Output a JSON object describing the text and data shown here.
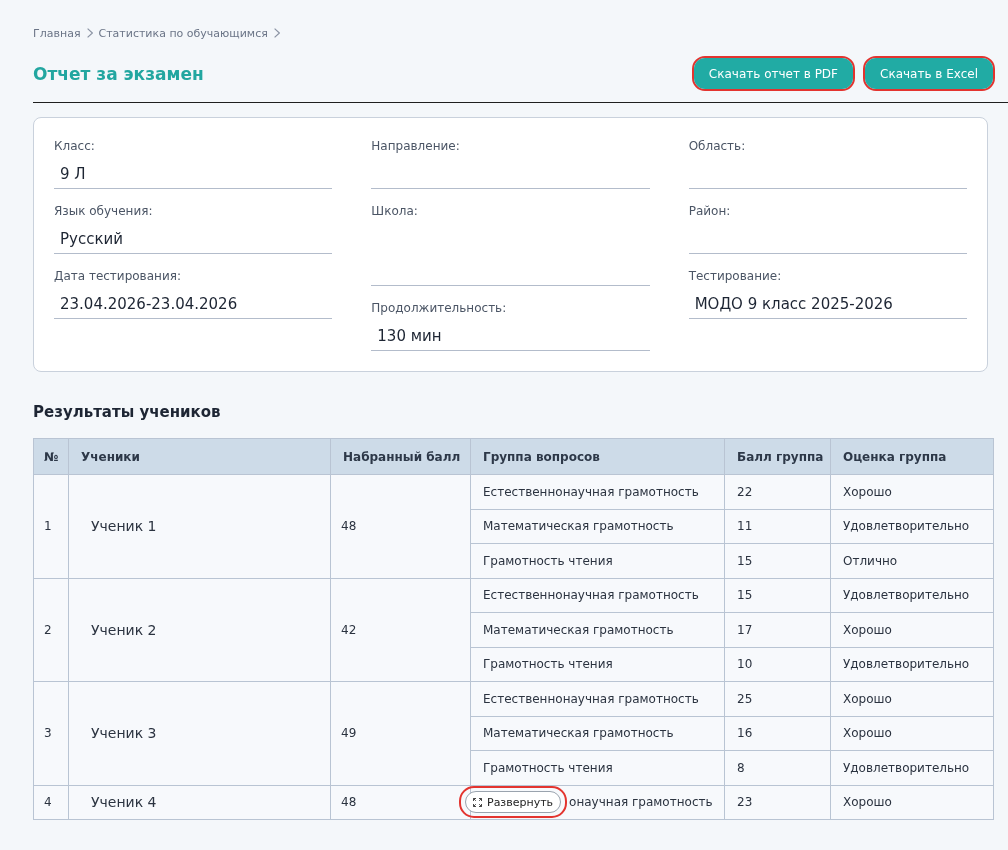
{
  "breadcrumbs": [
    {
      "label": "Главная"
    },
    {
      "label": "Статистика по обучающимся"
    }
  ],
  "header": {
    "title": "Отчет за экзамен",
    "buttons": [
      {
        "label": "Скачать отчет в PDF",
        "highlighted": true
      },
      {
        "label": "Скачать в Excel",
        "highlighted": true
      }
    ]
  },
  "info": {
    "columns": [
      [
        {
          "label": "Класс:",
          "value": "9 Л",
          "kind": "input"
        },
        {
          "label": "Язык обучения:",
          "value": "Русский",
          "kind": "input"
        },
        {
          "label": "Дата тестирования:",
          "value": "23.04.2026-23.04.2026",
          "kind": "input"
        }
      ],
      [
        {
          "label": "Направление:",
          "kind": "input"
        },
        {
          "label": "Школа:",
          "kind": "textarea"
        },
        {
          "label": "Продолжительность:",
          "value": "130 мин",
          "kind": "input"
        }
      ],
      [
        {
          "label": "Область:",
          "kind": "input"
        },
        {
          "label": "Район:",
          "kind": "input"
        },
        {
          "label": "Тестирование:",
          "value": "МОДО 9 класс 2025-2026",
          "kind": "input"
        }
      ]
    ]
  },
  "results": {
    "title": "Результаты учеников",
    "columns": [
      "№",
      "Ученики",
      "Набранный балл",
      "Группа вопросов",
      "Балл группа",
      "Оценка группа"
    ],
    "rows": [
      {
        "number": "1",
        "student": "Ученик 1",
        "score": "48",
        "groups": [
          {
            "name": "Естественнонаучная грамотность",
            "score": "22",
            "grade": "Хорошо"
          },
          {
            "name": "Математическая грамотность",
            "score": "11",
            "grade": "Удовлетворительно"
          },
          {
            "name": "Грамотность чтения",
            "score": "15",
            "grade": "Отлично"
          }
        ]
      },
      {
        "number": "2",
        "student": "Ученик 2",
        "score": "42",
        "groups": [
          {
            "name": "Естественнонаучная грамотность",
            "score": "15",
            "grade": "Удовлетворительно"
          },
          {
            "name": "Математическая грамотность",
            "score": "17",
            "grade": "Хорошо"
          },
          {
            "name": "Грамотность чтения",
            "score": "10",
            "grade": "Удовлетворительно"
          }
        ]
      },
      {
        "number": "3",
        "student": "Ученик 3",
        "score": "49",
        "groups": [
          {
            "name": "Естественнонаучная грамотность",
            "score": "25",
            "grade": "Хорошо"
          },
          {
            "name": "Математическая грамотность",
            "score": "16",
            "grade": "Хорошо"
          },
          {
            "name": "Грамотность чтения",
            "score": "8",
            "grade": "Удовлетворительно"
          }
        ]
      },
      {
        "number": "4",
        "student": "Ученик 4",
        "score": "48",
        "groups": [
          {
            "name": "онаучная грамотность",
            "score": "23",
            "grade": "Хорошо"
          }
        ]
      }
    ],
    "expand_button": {
      "label": "Развернуть",
      "highlighted": true
    }
  }
}
